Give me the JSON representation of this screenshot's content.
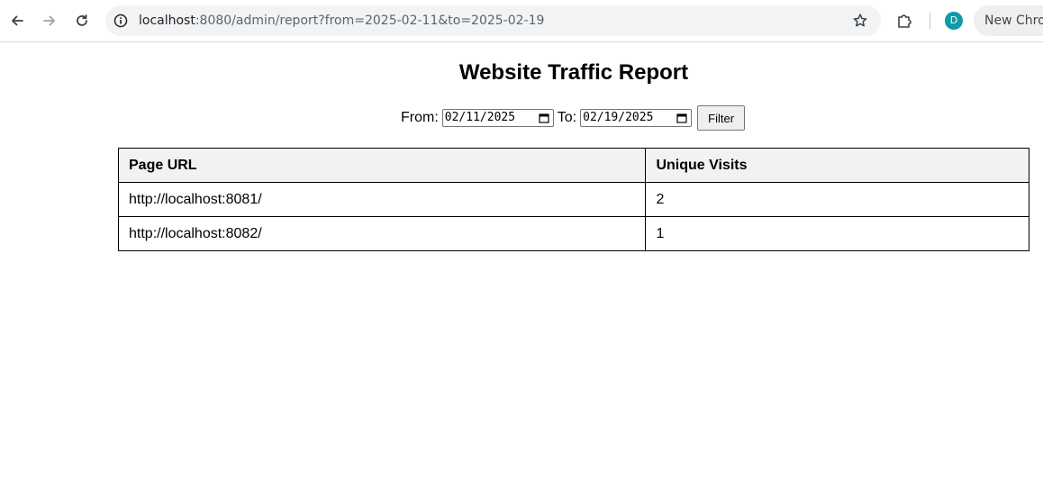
{
  "browser": {
    "url_host": "localhost",
    "url_rest": ":8080/admin/report?from=2025-02-11&to=2025-02-19",
    "avatar_letter": "D",
    "new_chrome_label": "New Chro"
  },
  "page": {
    "title": "Website Traffic Report",
    "filter": {
      "from_label": "From:",
      "from_value": "02/11/2025",
      "to_label": "To:",
      "to_value": "02/19/2025",
      "button_label": "Filter"
    },
    "table": {
      "headers": [
        "Page URL",
        "Unique Visits"
      ],
      "rows": [
        [
          "http://localhost:8081/",
          "2"
        ],
        [
          "http://localhost:8082/",
          "1"
        ]
      ]
    }
  }
}
